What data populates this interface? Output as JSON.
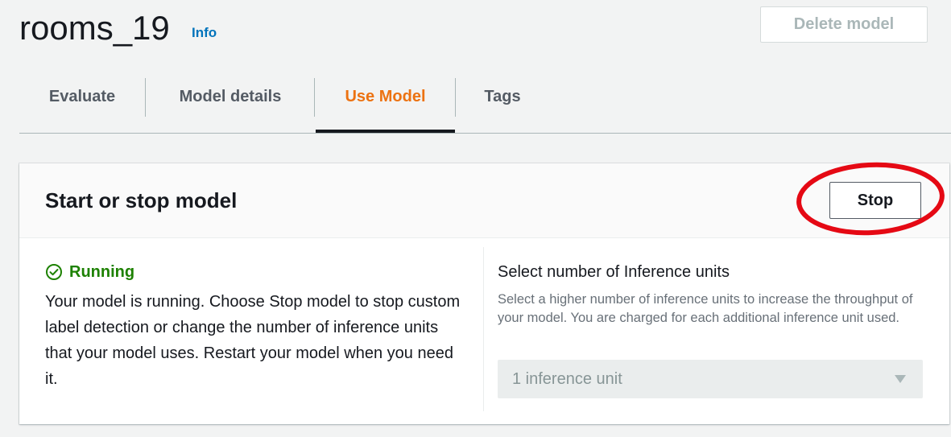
{
  "header": {
    "title": "rooms_19",
    "info_label": "Info",
    "delete_label": "Delete model"
  },
  "tabs": [
    {
      "label": "Evaluate",
      "active": false
    },
    {
      "label": "Model details",
      "active": false
    },
    {
      "label": "Use Model",
      "active": true
    },
    {
      "label": "Tags",
      "active": false
    }
  ],
  "panel": {
    "title": "Start or stop model",
    "stop_label": "Stop",
    "status": {
      "icon": "check-circle-icon",
      "text": "Running",
      "color": "#1d8102"
    },
    "description": "Your model is running. Choose Stop model to stop custom label detection or change the number of inference units that your model uses. Restart your model when you need it.",
    "inference": {
      "label": "Select number of Inference units",
      "help": "Select a higher number of inference units to increase the throughput of your model. You are charged for each additional inference unit used.",
      "selected": "1 inference unit",
      "disabled": true
    }
  },
  "colors": {
    "accent": "#ec7211",
    "link": "#0073bb",
    "highlight": "#e50914"
  }
}
